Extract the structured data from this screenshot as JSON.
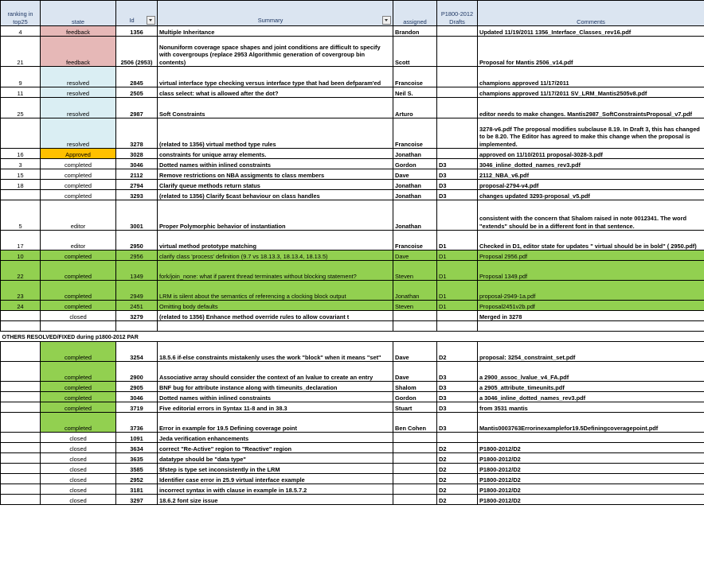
{
  "headers": {
    "rank": "ranking in top25",
    "state": "state",
    "id": "Id",
    "summary": "Summary",
    "assigned": "assigned",
    "drafts": "P1800-2012 Drafts",
    "comments": "Comments"
  },
  "rows": [
    {
      "rank": "4",
      "state": "feedback",
      "id": "1356",
      "summary": "Multiple Inheritance",
      "assigned": "Brandon",
      "draft": "",
      "comment": "Updated 11/19/2011     1356_Interface_Classes_rev16.pdf"
    },
    {
      "rank": "21",
      "state": "feedback",
      "id": "2506 (2953)",
      "summary": "Nonuniform coverage space shapes and joint conditions are difficult to specify with covergroups (replace 2953 Algorithmic generation of covergroup bin contents)",
      "assigned": "Scott",
      "draft": "",
      "comment": "Proposal for Mantis 2506_v14.pdf"
    },
    {
      "rank": "9",
      "state": "resolved",
      "id": "2845",
      "summary": "virtual interface type checking versus interface type that had been defparam'ed",
      "assigned": "Francoise",
      "draft": "",
      "comment": "champions approved 11/17/2011"
    },
    {
      "rank": "11",
      "state": "resolved",
      "id": "2505",
      "summary": "class select: what is allowed after the dot?",
      "assigned": "Neil S.",
      "draft": "",
      "comment": "champions approved 11/17/2011  SV_LRM_Mantis2505v8.pdf"
    },
    {
      "rank": "25",
      "state": "resolved",
      "id": "2987",
      "summary": "Soft Constraints",
      "assigned": "Arturo",
      "draft": "",
      "comment": "editor needs to make changes. Mantis2987_SoftConstraintsProposal_v7.pdf"
    },
    {
      "rank": "",
      "state": "resolved",
      "id": "3278",
      "summary": "(related to 1356) virtual method type rules",
      "assigned": "Francoise",
      "draft": "",
      "comment": "3278-v6.pdf  The proposal modifies subclause 8.19. In Draft 3, this has changed to be 8.20. The Editor has agreed to make this change when the proposal is implemented."
    },
    {
      "rank": "16",
      "state": "Approved",
      "id": "3028",
      "summary": "constraints for unique array elements.",
      "assigned": "Jonathan",
      "draft": "",
      "comment": "approved on 11/10/2011      proposal-3028-3.pdf"
    },
    {
      "rank": "3",
      "state": "completed",
      "id": "3046",
      "summary": "Dotted names within inlined constraints",
      "assigned": "Gordon",
      "draft": "D3",
      "comment": "3046_inline_dotted_names_rev3.pdf"
    },
    {
      "rank": "15",
      "state": "completed",
      "id": "2112",
      "summary": "Remove restrictions on NBA assigments to class members",
      "assigned": "Dave",
      "draft": "D3",
      "comment": "2112_NBA_v6.pdf"
    },
    {
      "rank": "18",
      "state": "completed",
      "id": "2794",
      "summary": "Clarify queue methods return status",
      "assigned": "Jonathan",
      "draft": "D3",
      "comment": "proposal-2794-v4.pdf"
    },
    {
      "rank": "",
      "state": "completed",
      "id": "3293",
      "summary": "(related to 1356) Clarify $cast behaviour on class handles",
      "assigned": "Jonathan",
      "draft": "D3",
      "comment": "changes updated  3293-proposal_v5.pdf"
    },
    {
      "rank": "5",
      "state": "editor",
      "id": "3001",
      "summary": "Proper Polymorphic behavior of instantiation",
      "assigned": "Jonathan",
      "draft": "",
      "comment": "consistent with the concern that Shalom raised in note 0012341. The word \"extends\" should be in a different font in that sentence."
    },
    {
      "rank": "17",
      "state": "editor",
      "id": "2950",
      "summary": "virtual method prototype matching",
      "assigned": "Francoise",
      "draft": "D1",
      "comment": "Checked in D1,  editor state for updates \" virtual  should be in bold\"  ( 2950.pdf)"
    },
    {
      "rank": "10",
      "state": "completed",
      "id": "2956",
      "summary": "clarify class 'process' definition (9.7 vs 18.13.3, 18.13.4, 18.13.5)",
      "assigned": "Dave",
      "draft": "D1",
      "comment": "Proposal 2956.pdf"
    },
    {
      "rank": "22",
      "state": "completed",
      "id": "1349",
      "summary": "fork/join_none: what if parent thread terminates without blocking statement?",
      "assigned": "Steven",
      "draft": "D1",
      "comment": "Proposal  1349.pdf"
    },
    {
      "rank": "23",
      "state": "completed",
      "id": "2949",
      "summary": "LRM is silent about the semantics of referencing a clocking block output",
      "assigned": "Jonathan",
      "draft": "D1",
      "comment": " proposal-2949-1a.pdf"
    },
    {
      "rank": "24",
      "state": "completed",
      "id": "2451",
      "summary": "Omitting body defaults",
      "assigned": "Steven",
      "draft": "D1",
      "comment": " Proposal2451v2b.pdf"
    },
    {
      "rank": "",
      "state": "closed",
      "id": "3279",
      "summary": "(related to 1356) Enhance method override rules to allow covariant t",
      "assigned": "",
      "draft": "",
      "comment": "Merged in 3278"
    },
    {
      "rank": "",
      "state": "",
      "id": "",
      "summary": "",
      "assigned": "",
      "draft": "",
      "comment": ""
    }
  ],
  "section_title": "OTHERS RESOLVED/FIXED during p1800-2012 PAR",
  "rows2": [
    {
      "state": "completed",
      "id": "3254",
      "summary": "18.5.6 if-else constraints mistakenly uses the work \"block\" when it means \"set\"",
      "assigned": "Dave",
      "draft": "D2",
      "comment": "proposal: 3254_constraint_set.pdf"
    },
    {
      "state": "completed",
      "id": "2900",
      "summary": "Associative array should consider the context of an lvalue to create an entry",
      "assigned": "Dave",
      "draft": "D3",
      "comment": "a  2900_assoc_lvalue_v4_FA.pdf"
    },
    {
      "state": "completed",
      "id": "2905",
      "summary": "BNF bug for attribute instance along with timeunits_declaration",
      "assigned": "Shalom",
      "draft": "D3",
      "comment": "a  2905_attribute_timeunits.pdf"
    },
    {
      "state": "completed",
      "id": "3046",
      "summary": "Dotted names within inlined constraints",
      "assigned": "Gordon",
      "draft": "D3",
      "comment": "a  3046_inline_dotted_names_rev3.pdf"
    },
    {
      "state": "completed",
      "id": "3719",
      "summary": "Five editorial errors in Syntax 11-8 and in 38.3",
      "assigned": "Stuart",
      "draft": "D3",
      "comment": "from 3531 mantis"
    },
    {
      "state": "completed",
      "id": "3736",
      "summary": "Error in example for 19.5 Defining coverage point",
      "assigned": "Ben Cohen",
      "draft": "D3",
      "comment": "Mantis0003763Errorinexamplefor19.5Definingcoveragepoint.pdf"
    },
    {
      "state": "closed",
      "id": "1091",
      "summary": "Jeda verification enhancements",
      "assigned": "",
      "draft": "",
      "comment": ""
    },
    {
      "state": "closed",
      "id": "3634",
      "summary": "correct \"Re-Active\" region to \"Reactive\" region",
      "assigned": "",
      "draft": "D2",
      "comment": "P1800-2012/D2"
    },
    {
      "state": "closed",
      "id": "3635",
      "summary": "datatype should be \"data type\"",
      "assigned": "",
      "draft": "D2",
      "comment": "P1800-2012/D2"
    },
    {
      "state": "closed",
      "id": "3585",
      "summary": "$fstep is type set inconsistently in the LRM",
      "assigned": "",
      "draft": "D2",
      "comment": "P1800-2012/D2"
    },
    {
      "state": "closed",
      "id": "2952",
      "summary": "Identifier case error in 25.9 virtual interface example",
      "assigned": "",
      "draft": "D2",
      "comment": "P1800-2012/D2"
    },
    {
      "state": "closed",
      "id": "3181",
      "summary": "incorrect syntax in with clause in example in 18.5.7.2",
      "assigned": "",
      "draft": "D2",
      "comment": "P1800-2012/D2"
    },
    {
      "state": "closed",
      "id": "3297",
      "summary": "18.6.2 font size issue",
      "assigned": "",
      "draft": "D2",
      "comment": "P1800-2012/D2"
    }
  ]
}
